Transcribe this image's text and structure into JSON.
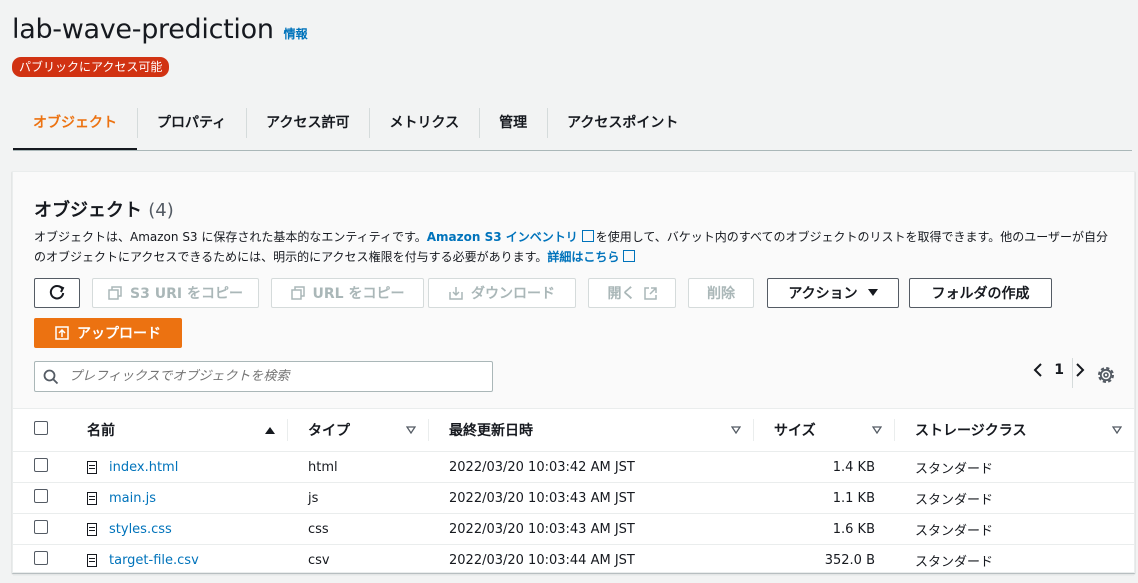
{
  "bucket": {
    "name": "lab-wave-prediction",
    "info_link": "情報",
    "public_badge": "パブリックにアクセス可能"
  },
  "tabs": [
    {
      "label": "オブジェクト",
      "active": true
    },
    {
      "label": "プロパティ"
    },
    {
      "label": "アクセス許可"
    },
    {
      "label": "メトリクス"
    },
    {
      "label": "管理"
    },
    {
      "label": "アクセスポイント"
    }
  ],
  "panel": {
    "title": "オブジェクト",
    "count": "(4)",
    "desc_part1": "オブジェクトは、Amazon S3 に保存された基本的なエンティティです。",
    "desc_link1": "Amazon S3 インベントリ",
    "desc_part2": "を使用して、バケット内のすべてのオブジェクトのリストを取得できます。他のユーザーが自分のオブジェクトにアクセスできるためには、明示的にアクセス権限を付与する必要があります。",
    "desc_link2": "詳細はこちら"
  },
  "toolbar": {
    "copy_s3_uri": "S3 URI をコピー",
    "copy_url": "URL をコピー",
    "download": "ダウンロード",
    "open": "開く",
    "delete": "削除",
    "actions": "アクション",
    "create_folder": "フォルダの作成",
    "upload": "アップロード"
  },
  "search": {
    "placeholder": "プレフィックスでオブジェクトを検索"
  },
  "pagination": {
    "page": "1"
  },
  "table": {
    "columns": [
      "名前",
      "タイプ",
      "最終更新日時",
      "サイズ",
      "ストレージクラス"
    ],
    "rows": [
      {
        "name": "index.html",
        "type": "html",
        "modified": "2022/03/20 10:03:42 AM JST",
        "size": "1.4 KB",
        "storage": "スタンダード"
      },
      {
        "name": "main.js",
        "type": "js",
        "modified": "2022/03/20 10:03:43 AM JST",
        "size": "1.1 KB",
        "storage": "スタンダード"
      },
      {
        "name": "styles.css",
        "type": "css",
        "modified": "2022/03/20 10:03:43 AM JST",
        "size": "1.6 KB",
        "storage": "スタンダード"
      },
      {
        "name": "target-file.csv",
        "type": "csv",
        "modified": "2022/03/20 10:03:44 AM JST",
        "size": "352.0 B",
        "storage": "スタンダード"
      }
    ]
  },
  "colors": {
    "accent": "#ec7211",
    "link": "#0073bb",
    "badge": "#d13212"
  }
}
